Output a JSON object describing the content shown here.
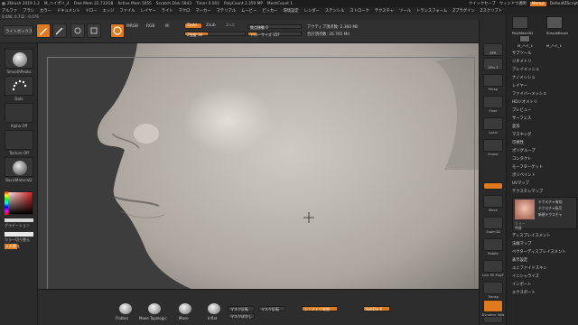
{
  "titlebar": {
    "items": [
      "ZBrush 2019.1.2",
      "M_ハイポリ_4",
      "Free Mem 22.732GB",
      "Active Mem 5055",
      "Scratch Disk 5843",
      "Timer 0.002",
      "PolyCount 2.359 MP",
      "MeshCount 1"
    ],
    "right": [
      "クイックセーブ",
      "ウィンドウ透明",
      "Menus",
      "DefaultZScript"
    ]
  },
  "menubar": {
    "items": [
      "アルファ",
      "ブラシ",
      "カラー",
      "ドキュメント",
      "ドロー",
      "エッジ",
      "ファイル",
      "レイヤー",
      "ライト",
      "マクロ",
      "マーカー",
      "マテリアル",
      "ムービー",
      "ピッカー",
      "環境設定",
      "レンダー",
      "ステンシル",
      "ストローク",
      "テクスチャ",
      "ツール",
      "トランスフォーム",
      "Zプラグイン",
      "Zスクリプト"
    ]
  },
  "infobar": {
    "text": "0.046, 0.732, -0.076"
  },
  "toolbar": {
    "lightbox": "ライトボックス",
    "mrgb": "MRGB",
    "rgb": "RGB",
    "m": "M",
    "zadd": "Zadd",
    "zsub": "Zsub",
    "zcut": "Zcut",
    "intensity_label": "Z強度 38",
    "intensity_value": 0.38,
    "focal_shift_label": "焦点移動 0",
    "draw_size_label": "ドローサイズ 157",
    "draw_size_value": 0.16,
    "active_points": "アクティブ頂点数: 2.360 Mil",
    "total_points": "合計頂点数: 26.765 Mil"
  },
  "lefttray": {
    "brush": "SmoothPeaks",
    "stroke": "Dots",
    "alpha": "Alpha Off",
    "texture": "Texture Off",
    "material": "BasicMaterial2",
    "gradient": "グラデーション",
    "switch_color": "カラー切り替え",
    "alternate": "入れ替え"
  },
  "bottombar": {
    "brushes": [
      "Flatten",
      "Move Topologic",
      "Move",
      "Inflat"
    ],
    "mask_invert": "マスク反転",
    "mask_clear": "マスク反転",
    "mask_blur": "マスクぼかし",
    "symmetry": "シンメトリ有効",
    "subdiv": "SubDiv 6"
  },
  "rightshelf": {
    "buttons": [
      "BPR",
      "SPix 3",
      "Persp",
      "Floor",
      "Local",
      "Frame",
      "Move",
      "Zoom3D",
      "Rotate",
      "Line Fill PolyF",
      "Transp",
      "Dynamic Solo",
      "Xpose"
    ]
  },
  "palette": {
    "head_tools": [
      "PolyMesh3D",
      "SimpleBrush",
      "M_ハイ_1",
      "M_ハイ_1"
    ],
    "items": [
      "サブツール",
      "ジオメトリ",
      "アレイメッシュ",
      "ナノメッシュ",
      "レイヤー",
      "ファイバーメッシュ",
      "HDジオメトリ",
      "プレビュー",
      "サーフェス",
      "変形",
      "マスキング",
      "可視性",
      "ポリグループ",
      "コンタクト",
      "モーフターゲット",
      "ポリペイント",
      "UVマップ",
      "テクスチャマップ"
    ],
    "texmap_buttons": [
      "テクスチャ有効",
      "テクスチャ転写",
      "新規テクスチャ"
    ],
    "texmap_extra": [
      "カラー",
      "作成"
    ],
    "items2": [
      "ディスプレイスメント",
      "法線マップ",
      "ベクターディスプレイスメント",
      "表示設定",
      "ユニファイドスキン",
      "イニシャライズ",
      "インポート",
      "エクスポート"
    ]
  },
  "colors": {
    "accent": "#e07a1f",
    "background": "#2a2a2a",
    "clay": "#b8b3ac"
  }
}
